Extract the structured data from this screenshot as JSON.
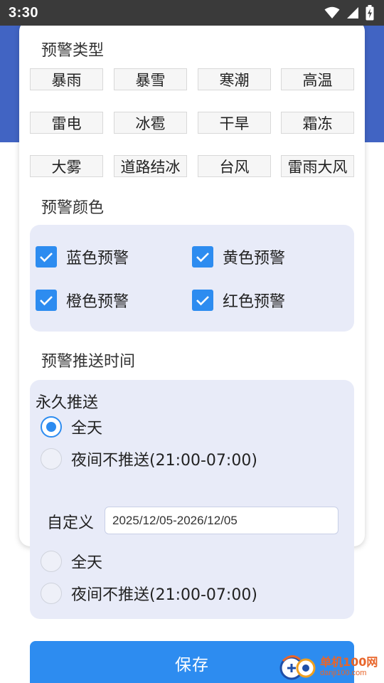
{
  "status_bar": {
    "time": "3:30",
    "icons": [
      "wifi-icon",
      "signal-icon",
      "battery-charging-icon"
    ]
  },
  "warning_type": {
    "title": "预警类型",
    "items": [
      "暴雨",
      "暴雪",
      "寒潮",
      "高温",
      "雷电",
      "冰雹",
      "干旱",
      "霜冻",
      "大雾",
      "道路结冰",
      "台风",
      "雷雨大风"
    ]
  },
  "warning_color": {
    "title": "预警颜色",
    "items": [
      {
        "label": "蓝色预警",
        "checked": true
      },
      {
        "label": "黄色预警",
        "checked": true
      },
      {
        "label": "橙色预警",
        "checked": true
      },
      {
        "label": "红色预警",
        "checked": true
      }
    ]
  },
  "push_time": {
    "title": "预警推送时间",
    "permanent": {
      "label": "永久推送",
      "options": [
        {
          "label": "全天",
          "selected": true
        },
        {
          "label": "夜间不推送(21:00-07:00)",
          "selected": false
        }
      ]
    },
    "custom": {
      "label": "自定义",
      "date_range": "2025/12/05-2026/12/05",
      "options": [
        {
          "label": "全天",
          "selected": false
        },
        {
          "label": "夜间不推送(21:00-07:00)",
          "selected": false
        }
      ]
    }
  },
  "save_label": "保存",
  "watermark": {
    "main": "单机100网",
    "sub": "danji100.com"
  },
  "colors": {
    "accent": "#2d8cf0",
    "header": "#4164c3",
    "panel": "#e8ebf8"
  }
}
